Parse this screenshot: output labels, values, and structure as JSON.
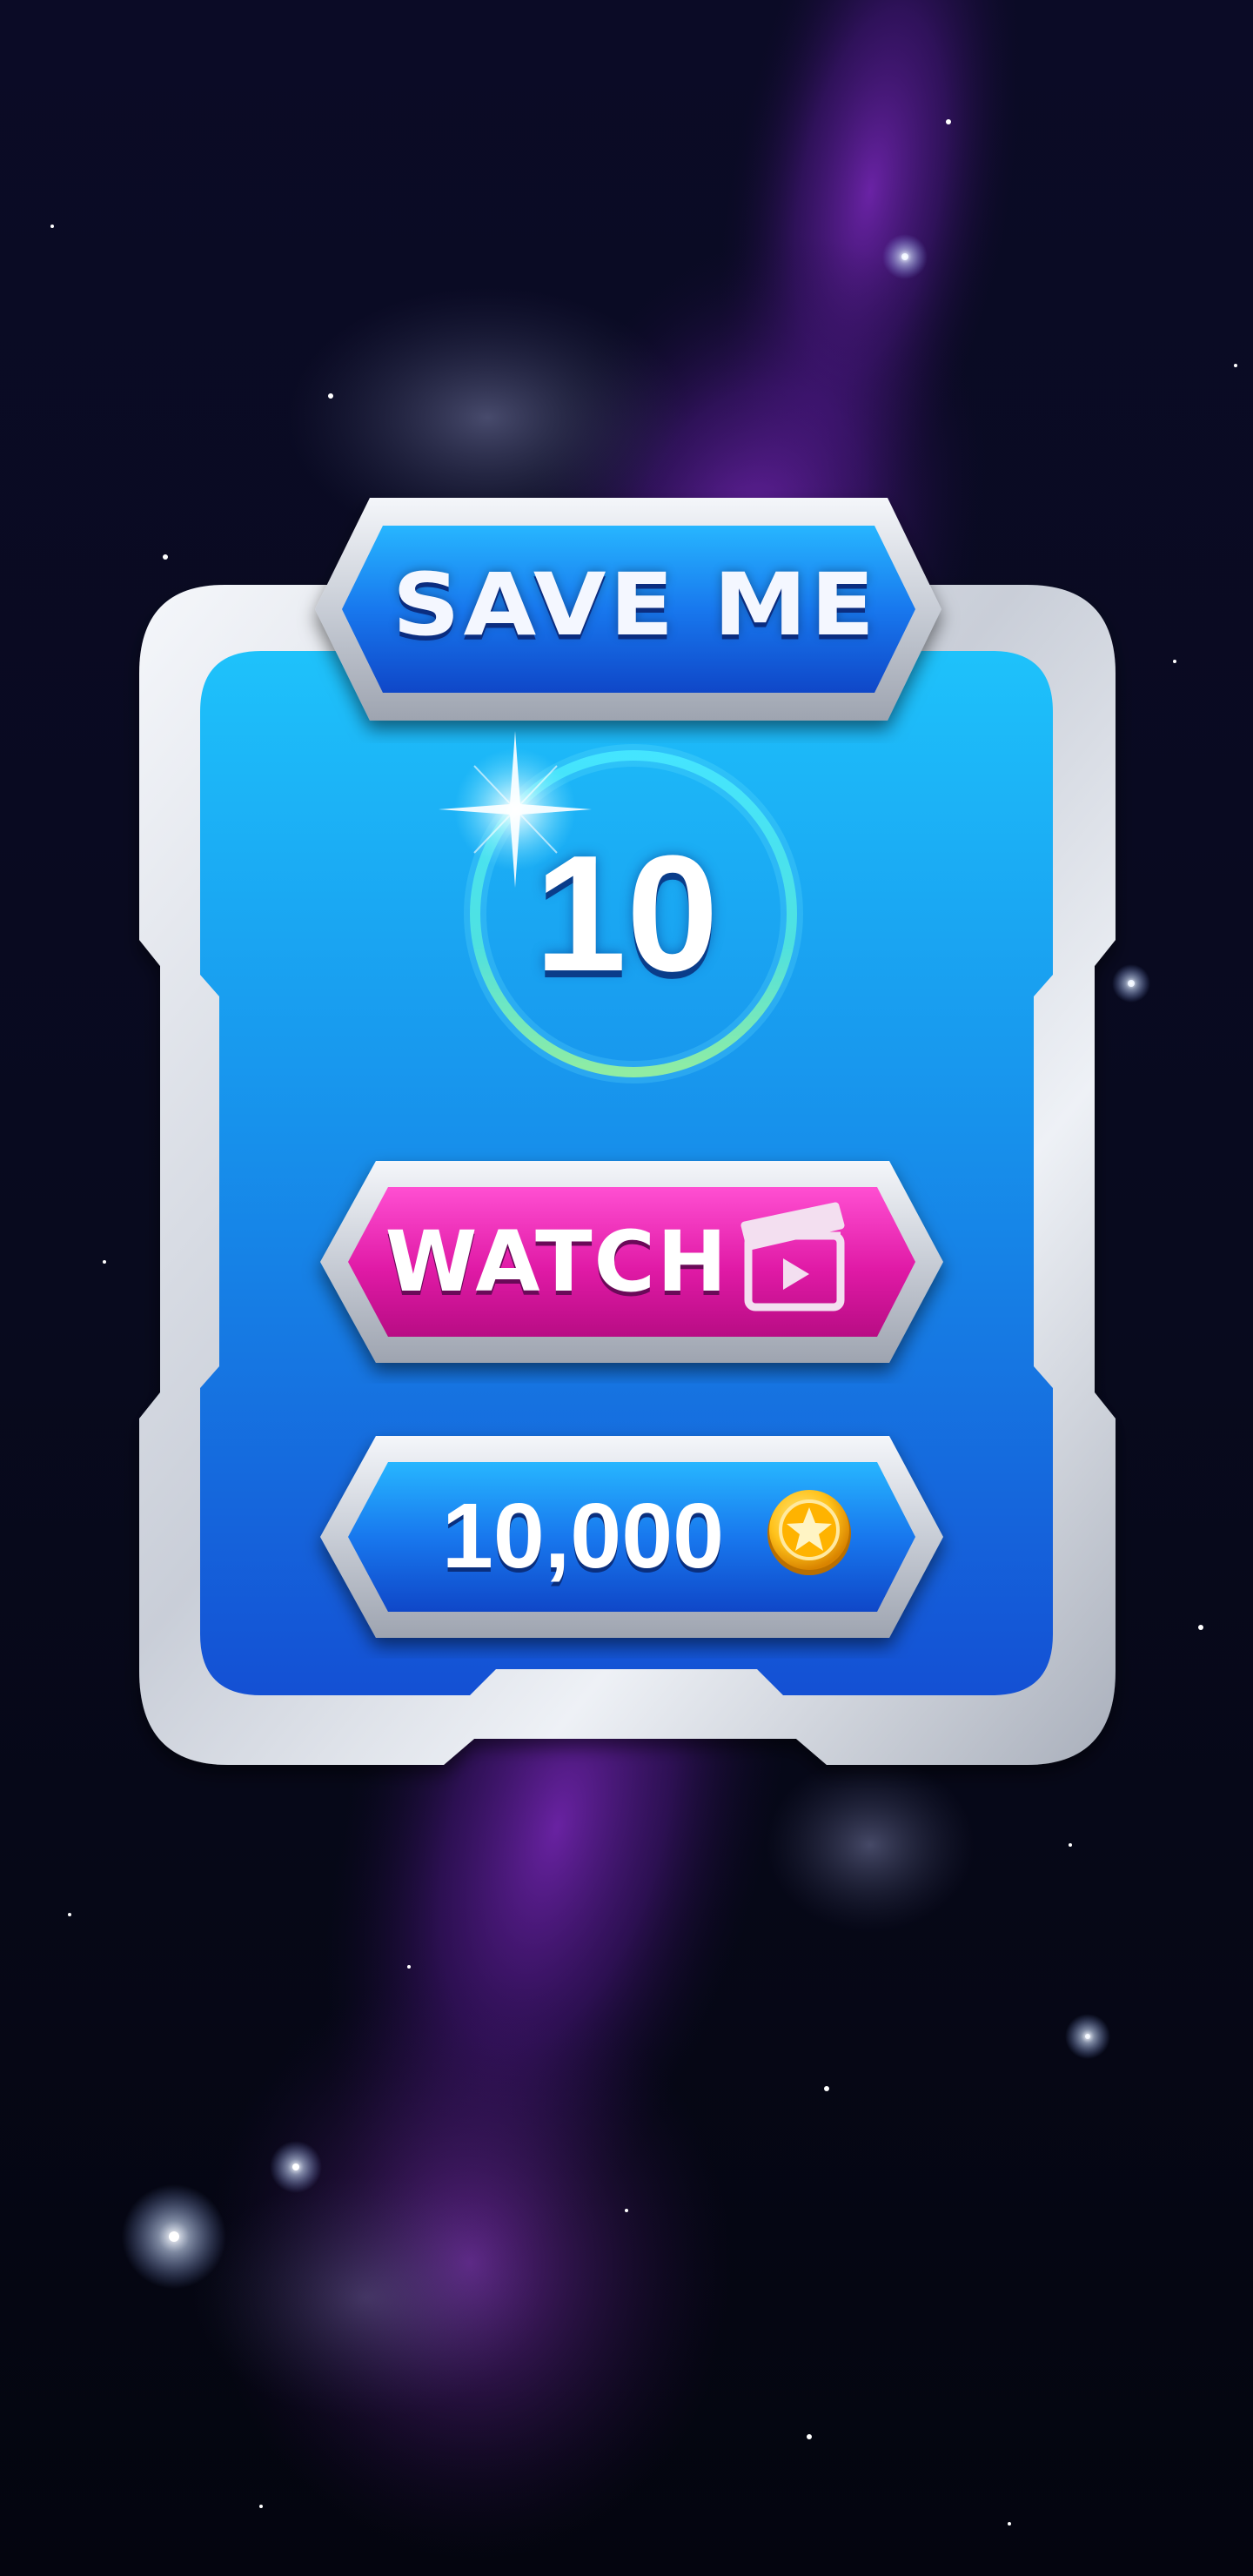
{
  "dialog": {
    "title": "SAVE ME",
    "countdown": "10",
    "countdown_progress": 1.0
  },
  "watch_button": {
    "label": "WATCH",
    "icon": "clapperboard-icon"
  },
  "buy_button": {
    "price": "10,000",
    "icon": "gold-coin-star-icon"
  },
  "colors": {
    "panel_blue": "#18b8f6",
    "panel_blue_dark": "#1753d6",
    "frame_silver": "#dde2ea",
    "watch_pink": "#e018a8",
    "coin_gold": "#ffc21a",
    "background_space": "#050816",
    "nebula_purple": "#7a1fb0"
  }
}
